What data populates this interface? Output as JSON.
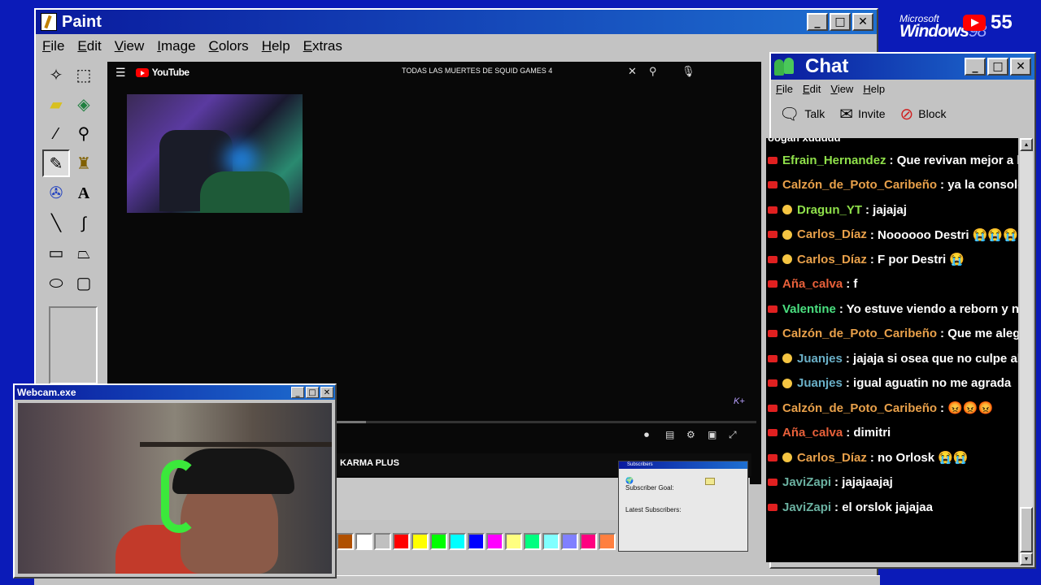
{
  "paint": {
    "title": "Paint",
    "menu": [
      "File",
      "Edit",
      "View",
      "Image",
      "Colors",
      "Help",
      "Extras"
    ],
    "tools": [
      "free-select-icon",
      "rect-select-icon",
      "eraser-icon",
      "fill-icon",
      "color-picker-icon",
      "magnifier-icon",
      "pencil-icon",
      "brush-icon",
      "airbrush-icon",
      "text-icon",
      "line-icon",
      "curve-icon",
      "rectangle-icon",
      "polygon-icon",
      "ellipse-icon",
      "rounded-rect-icon"
    ],
    "palette": [
      "#b05000",
      "#ffffff",
      "#c0c0c0",
      "#ff0000",
      "#ffff00",
      "#00ff00",
      "#00ffff",
      "#0000ff",
      "#ff00ff",
      "#ffff80",
      "#00ff80",
      "#80ffff",
      "#8080ff",
      "#ff0080",
      "#ff8040"
    ]
  },
  "youtube": {
    "logo": "YouTube",
    "search_query": "TODAS LAS MUERTES DE SQUID GAMES 4",
    "clear_icon": "✕",
    "channel_label": "KARMA PLUS",
    "kplus_badge": "K+",
    "progress": 0.38
  },
  "subscribers": {
    "title": "Subscribers",
    "goal_label": "Subscriber Goal:",
    "latest_label": "Latest Subscribers:"
  },
  "webcam": {
    "title": "Webcam.exe"
  },
  "chat": {
    "title": "Chat",
    "menu": [
      "File",
      "Edit",
      "View",
      "Help"
    ],
    "tools": [
      {
        "label": "Talk",
        "icon": "talk-icon"
      },
      {
        "label": "Invite",
        "icon": "invite-icon"
      },
      {
        "label": "Block",
        "icon": "block-icon"
      }
    ],
    "partial_top": "oogan xddddd",
    "messages": [
      {
        "user": "Efrain_Hernandez",
        "text": "Que revivan mejor a la",
        "color": "#8fe04a",
        "mod": false
      },
      {
        "user": "Calzón_de_Poto_Caribeño",
        "text": "ya la consolé",
        "color": "#e8a04a",
        "mod": false
      },
      {
        "user": "Dragun_YT",
        "text": "jajajaj",
        "color": "#8fe04a",
        "mod": true
      },
      {
        "user": "Carlos_Díaz",
        "text": "Noooooo Destri 😭😭😭",
        "color": "#e8a04a",
        "mod": true
      },
      {
        "user": "Carlos_Díaz",
        "text": "F por Destri 😭",
        "color": "#e8a04a",
        "mod": true
      },
      {
        "user": "Aña_calva",
        "text": "f",
        "color": "#e8603a",
        "mod": false
      },
      {
        "user": "Valentine",
        "text": "Yo estuve viendo a reborn y no",
        "color": "#4ae080",
        "mod": false
      },
      {
        "user": "Calzón_de_Poto_Caribeño",
        "text": "Que me alegro",
        "color": "#e8a04a",
        "mod": false
      },
      {
        "user": "Juanjes",
        "text": "jajaja si osea que no culpe al ju",
        "color": "#6ab0c8",
        "mod": true
      },
      {
        "user": "Juanjes",
        "text": "igual aguatin no me agrada",
        "color": "#6ab0c8",
        "mod": true
      },
      {
        "user": "Calzón_de_Poto_Caribeño",
        "text": "😡😡😡",
        "color": "#e8a04a",
        "mod": false
      },
      {
        "user": "Aña_calva",
        "text": "dimitri",
        "color": "#e8603a",
        "mod": false
      },
      {
        "user": "Carlos_Díaz",
        "text": "no Orlosk 😭😭",
        "color": "#e8a04a",
        "mod": true
      },
      {
        "user": "JaviZapi",
        "text": "jajajaajaj",
        "color": "#6ab0a0",
        "mod": false
      },
      {
        "user": "JaviZapi",
        "text": "el orslok jajajaa",
        "color": "#6ab0a0",
        "mod": false
      }
    ]
  },
  "branding": {
    "ms": "Microsoft",
    "win": "Windows",
    "ver": "98",
    "count": "55"
  }
}
